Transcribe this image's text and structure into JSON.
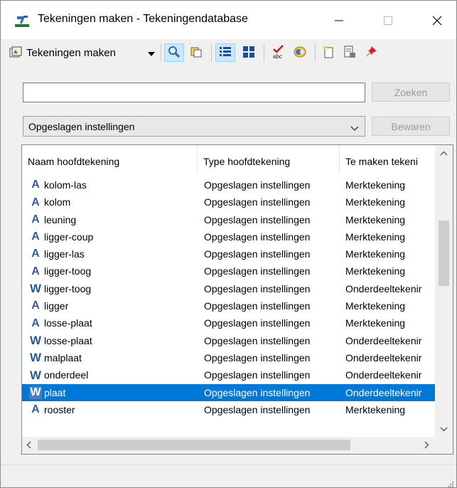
{
  "window": {
    "title": "Tekeningen maken - Tekeningendatabase",
    "minimize_icon": "minimize-icon",
    "maximize_icon": "maximize-icon",
    "close_icon": "close-icon"
  },
  "toolbar": {
    "create_drawings_label": "Tekeningen maken",
    "items": [
      "create-drawings-icon",
      "dropdown-arrow-icon",
      "search-icon",
      "copy-icon",
      "list-view-icon",
      "grid-view-icon",
      "spell-check-icon",
      "refresh-icon",
      "new-icon",
      "properties-icon",
      "pin-icon"
    ]
  },
  "search": {
    "value": "",
    "placeholder": "",
    "button_label": "Zoeken"
  },
  "settings": {
    "selected": "Opgeslagen instellingen",
    "save_label": "Bewaren"
  },
  "list": {
    "columns": [
      "Naam hoofdtekening",
      "Type hoofdtekening",
      "Te maken tekeni"
    ],
    "rows": [
      {
        "icon": "A",
        "name": "kolom-las",
        "type": "Opgeslagen instellingen",
        "make": "Merktekening",
        "selected": false
      },
      {
        "icon": "A",
        "name": "kolom",
        "type": "Opgeslagen instellingen",
        "make": "Merktekening",
        "selected": false
      },
      {
        "icon": "A",
        "name": "leuning",
        "type": "Opgeslagen instellingen",
        "make": "Merktekening",
        "selected": false
      },
      {
        "icon": "A",
        "name": "ligger-coup",
        "type": "Opgeslagen instellingen",
        "make": "Merktekening",
        "selected": false
      },
      {
        "icon": "A",
        "name": "ligger-las",
        "type": "Opgeslagen instellingen",
        "make": "Merktekening",
        "selected": false
      },
      {
        "icon": "A",
        "name": "ligger-toog",
        "type": "Opgeslagen instellingen",
        "make": "Merktekening",
        "selected": false
      },
      {
        "icon": "W",
        "name": "ligger-toog",
        "type": "Opgeslagen instellingen",
        "make": "Onderdeeltekenir",
        "selected": false
      },
      {
        "icon": "A",
        "name": "ligger",
        "type": "Opgeslagen instellingen",
        "make": "Merktekening",
        "selected": false
      },
      {
        "icon": "A",
        "name": "losse-plaat",
        "type": "Opgeslagen instellingen",
        "make": "Merktekening",
        "selected": false
      },
      {
        "icon": "W",
        "name": "losse-plaat",
        "type": "Opgeslagen instellingen",
        "make": "Onderdeeltekenir",
        "selected": false
      },
      {
        "icon": "W",
        "name": "malplaat",
        "type": "Opgeslagen instellingen",
        "make": "Onderdeeltekenir",
        "selected": false
      },
      {
        "icon": "W",
        "name": "onderdeel",
        "type": "Opgeslagen instellingen",
        "make": "Onderdeeltekenir",
        "selected": false
      },
      {
        "icon": "W",
        "name": "plaat",
        "type": "Opgeslagen instellingen",
        "make": "Onderdeeltekenir",
        "selected": true
      },
      {
        "icon": "A",
        "name": "rooster",
        "type": "Opgeslagen instellingen",
        "make": "Merktekening",
        "selected": false
      }
    ]
  },
  "colors": {
    "selection": "#0078d7",
    "window_bg": "#f0f0f0",
    "disabled_text": "#9b9b9b"
  }
}
